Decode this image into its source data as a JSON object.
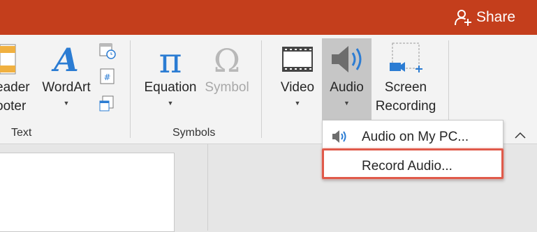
{
  "titlebar": {
    "share_label": "Share"
  },
  "ribbon": {
    "buttons": {
      "header_footer": {
        "line1": "eader",
        "line2": "ooter"
      },
      "wordart": {
        "label": "WordArt"
      },
      "equation": {
        "label": "Equation"
      },
      "symbol": {
        "label": "Symbol"
      },
      "video": {
        "label": "Video"
      },
      "audio": {
        "label": "Audio"
      },
      "screen_recording": {
        "line1": "Screen",
        "line2": "Recording"
      }
    },
    "groups": {
      "text": "Text",
      "symbols": "Symbols"
    }
  },
  "audio_menu": {
    "items": [
      {
        "label": "Audio on My PC...",
        "icon": "speaker-icon"
      },
      {
        "label": "Record Audio...",
        "icon": "none"
      }
    ]
  },
  "colors": {
    "title_bar": "#c43e1c",
    "highlight_border": "#e05a4a",
    "accent_blue": "#2b7cd3"
  }
}
